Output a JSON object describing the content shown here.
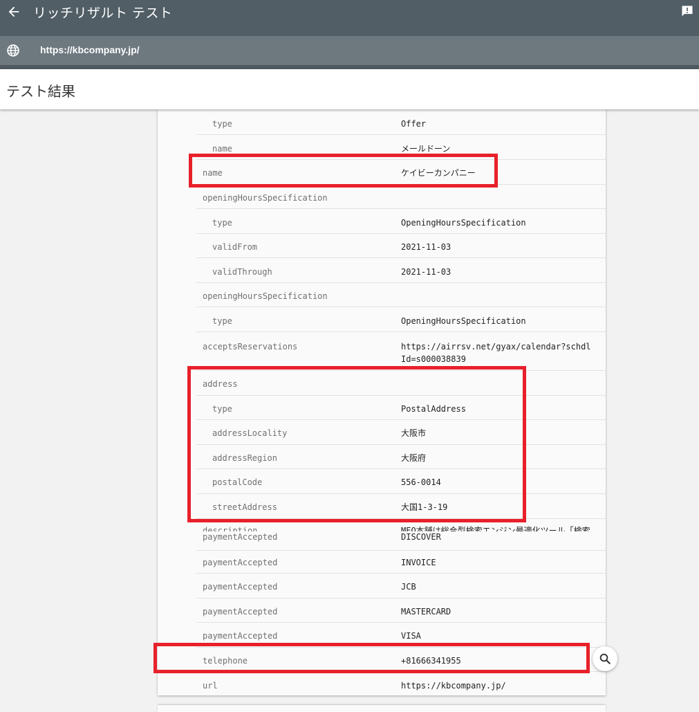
{
  "header": {
    "title": "リッチリザルト テスト"
  },
  "urlbar": {
    "url": "https://kbcompany.jp/"
  },
  "results": {
    "title": "テスト結果"
  },
  "rows": [
    {
      "key": "type",
      "value": "Offer"
    },
    {
      "key": "name",
      "value": "メールドーン"
    },
    {
      "key": "name",
      "value": "ケイビーカンパニー"
    },
    {
      "key": "openingHoursSpecification",
      "value": ""
    },
    {
      "key": "type",
      "value": "OpeningHoursSpecification"
    },
    {
      "key": "validFrom",
      "value": "2021-11-03"
    },
    {
      "key": "validThrough",
      "value": "2021-11-03"
    },
    {
      "key": "openingHoursSpecification",
      "value": ""
    },
    {
      "key": "type",
      "value": "OpeningHoursSpecification"
    },
    {
      "key": "acceptsReservations",
      "value": "https://airrsv.net/gyax/calendar?schdlId=s000038839"
    },
    {
      "key": "address",
      "value": ""
    },
    {
      "key": "type",
      "value": "PostalAddress"
    },
    {
      "key": "addressLocality",
      "value": "大阪市"
    },
    {
      "key": "addressRegion",
      "value": "大阪府"
    },
    {
      "key": "postalCode",
      "value": "556-0014"
    },
    {
      "key": "streetAddress",
      "value": "大国1-3-19"
    },
    {
      "key": "description",
      "value": "MEO本舗は総合型検索エンジン最適化ツール「検索"
    },
    {
      "key": "paymentAccepted",
      "value": "DISCOVER"
    },
    {
      "key": "paymentAccepted",
      "value": "INVOICE"
    },
    {
      "key": "paymentAccepted",
      "value": "JCB"
    },
    {
      "key": "paymentAccepted",
      "value": "MASTERCARD"
    },
    {
      "key": "paymentAccepted",
      "value": "VISA"
    },
    {
      "key": "telephone",
      "value": "+81666341955"
    },
    {
      "key": "url",
      "value": "https://kbcompany.jp/"
    }
  ],
  "colors": {
    "highlight": "#e8202a",
    "topbar": "#525e66",
    "urlbar": "#6d787f"
  }
}
